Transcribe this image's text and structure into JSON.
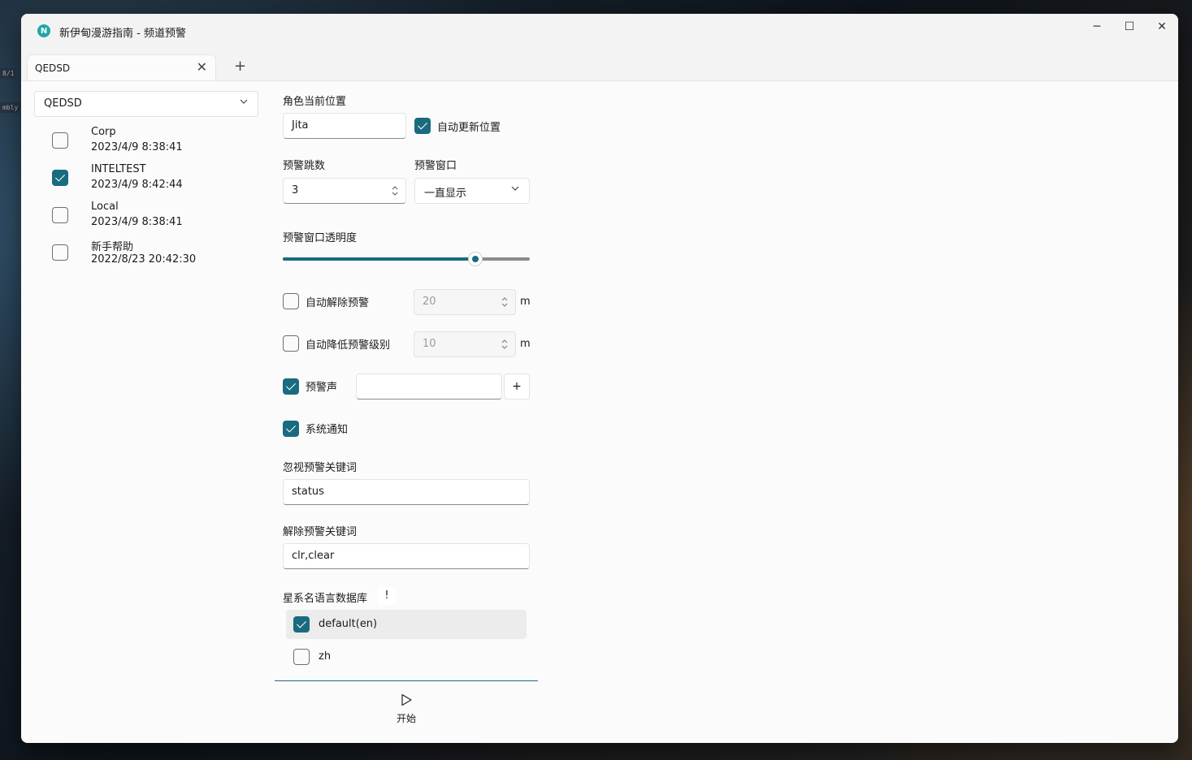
{
  "desktop": {
    "badge1": "8/1",
    "badge2": "mbly"
  },
  "window": {
    "title": "新伊甸漫游指南 - 频道预警",
    "app_icon_letter": "N",
    "minimize": "─",
    "maximize": "☐",
    "close": "✕"
  },
  "tabs": [
    {
      "label": "QEDSD",
      "close": "✕"
    }
  ],
  "tab_add": "+",
  "sidebar": {
    "profile": "QEDSD",
    "channels": [
      {
        "name": "Corp",
        "time": "2023/4/9 8:38:41",
        "checked": false
      },
      {
        "name": "INTELTEST",
        "time": "2023/4/9 8:42:44",
        "checked": true
      },
      {
        "name": "Local",
        "time": "2023/4/9 8:38:41",
        "checked": false
      },
      {
        "name": "新手帮助",
        "time": "2022/8/23 20:42:30",
        "checked": false
      }
    ]
  },
  "settings": {
    "location_label": "角色当前位置",
    "location_value": "Jita",
    "auto_update_label": "自动更新位置",
    "auto_update_checked": true,
    "jumps_label": "预警跳数",
    "jumps_value": "3",
    "window_label": "预警窗口",
    "window_value": "一直显示",
    "opacity_label": "预警窗口透明度",
    "opacity_fraction": 0.78,
    "auto_clear_label": "自动解除预警",
    "auto_clear_checked": false,
    "auto_clear_value": "20",
    "auto_clear_unit": "m",
    "auto_down_label": "自动降低预警级别",
    "auto_down_checked": false,
    "auto_down_value": "10",
    "auto_down_unit": "m",
    "sound_label": "预警声",
    "sound_checked": true,
    "sound_value": "",
    "sound_add": "+",
    "notify_label": "系统通知",
    "notify_checked": true,
    "ignore_label": "忽视预警关键词",
    "ignore_value": "status",
    "clear_label": "解除预警关键词",
    "clear_value": "clr,clear",
    "db_label": "星系名语言数据库",
    "db_info": "!",
    "db_items": [
      {
        "name": "default(en)",
        "checked": true
      },
      {
        "name": "zh",
        "checked": false
      }
    ],
    "start_label": "开始"
  },
  "colors": {
    "accent": "#1a6b7f",
    "app_icon": "#22a6a8"
  }
}
